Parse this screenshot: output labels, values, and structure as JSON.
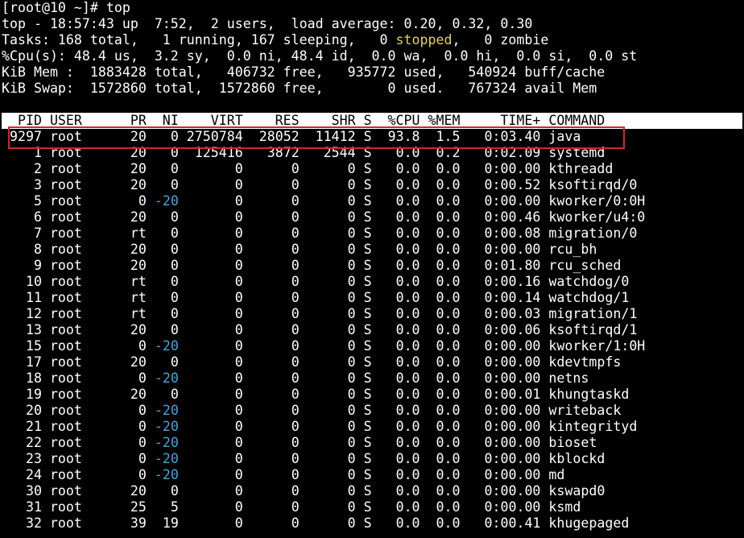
{
  "prompt": {
    "text": "[root@10 ~]# top"
  },
  "summary": {
    "uptime_line": "top - 18:57:43 up  7:52,  2 users,  load average: 0.20, 0.32, 0.30",
    "tasks_before": "Tasks: 168 total,   1 running, 167 sleeping,   0 ",
    "tasks_stopped_word": "stopped",
    "tasks_after": ",   0 zombie",
    "cpu_line": "%Cpu(s): 48.4 us,  3.2 sy,  0.0 ni, 48.4 id,  0.0 wa,  0.0 hi,  0.0 si,  0.0 st",
    "mem_line": "KiB Mem :  1883428 total,   406732 free,   935772 used,   540924 buff/cache",
    "swap_line": "KiB Swap:  1572860 total,  1572860 free,        0 used.   767324 avail Mem"
  },
  "table": {
    "header": "  PID USER      PR  NI    VIRT    RES    SHR S  %CPU %MEM     TIME+ COMMAND",
    "columns": [
      "PID",
      "USER",
      "PR",
      "NI",
      "VIRT",
      "RES",
      "SHR",
      "S",
      "%CPU",
      "%MEM",
      "TIME+",
      "COMMAND"
    ],
    "selected_pid": "9297",
    "rows": [
      {
        "pid": "9297",
        "user": "root",
        "pr": "20",
        "ni": "0",
        "virt": "2750784",
        "res": "28052",
        "shr": "11412",
        "s": "S",
        "cpu": "93.8",
        "mem": "1.5",
        "time": "0:03.40",
        "command": "java"
      },
      {
        "pid": "1",
        "user": "root",
        "pr": "20",
        "ni": "0",
        "virt": "125416",
        "res": "3872",
        "shr": "2544",
        "s": "S",
        "cpu": "0.0",
        "mem": "0.2",
        "time": "0:02.09",
        "command": "systemd"
      },
      {
        "pid": "2",
        "user": "root",
        "pr": "20",
        "ni": "0",
        "virt": "0",
        "res": "0",
        "shr": "0",
        "s": "S",
        "cpu": "0.0",
        "mem": "0.0",
        "time": "0:00.00",
        "command": "kthreadd"
      },
      {
        "pid": "3",
        "user": "root",
        "pr": "20",
        "ni": "0",
        "virt": "0",
        "res": "0",
        "shr": "0",
        "s": "S",
        "cpu": "0.0",
        "mem": "0.0",
        "time": "0:00.52",
        "command": "ksoftirqd/0"
      },
      {
        "pid": "5",
        "user": "root",
        "pr": "0",
        "ni": "-20",
        "virt": "0",
        "res": "0",
        "shr": "0",
        "s": "S",
        "cpu": "0.0",
        "mem": "0.0",
        "time": "0:00.00",
        "command": "kworker/0:0H"
      },
      {
        "pid": "6",
        "user": "root",
        "pr": "20",
        "ni": "0",
        "virt": "0",
        "res": "0",
        "shr": "0",
        "s": "S",
        "cpu": "0.0",
        "mem": "0.0",
        "time": "0:00.46",
        "command": "kworker/u4:0"
      },
      {
        "pid": "7",
        "user": "root",
        "pr": "rt",
        "ni": "0",
        "virt": "0",
        "res": "0",
        "shr": "0",
        "s": "S",
        "cpu": "0.0",
        "mem": "0.0",
        "time": "0:00.08",
        "command": "migration/0"
      },
      {
        "pid": "8",
        "user": "root",
        "pr": "20",
        "ni": "0",
        "virt": "0",
        "res": "0",
        "shr": "0",
        "s": "S",
        "cpu": "0.0",
        "mem": "0.0",
        "time": "0:00.00",
        "command": "rcu_bh"
      },
      {
        "pid": "9",
        "user": "root",
        "pr": "20",
        "ni": "0",
        "virt": "0",
        "res": "0",
        "shr": "0",
        "s": "S",
        "cpu": "0.0",
        "mem": "0.0",
        "time": "0:01.80",
        "command": "rcu_sched"
      },
      {
        "pid": "10",
        "user": "root",
        "pr": "rt",
        "ni": "0",
        "virt": "0",
        "res": "0",
        "shr": "0",
        "s": "S",
        "cpu": "0.0",
        "mem": "0.0",
        "time": "0:00.16",
        "command": "watchdog/0"
      },
      {
        "pid": "11",
        "user": "root",
        "pr": "rt",
        "ni": "0",
        "virt": "0",
        "res": "0",
        "shr": "0",
        "s": "S",
        "cpu": "0.0",
        "mem": "0.0",
        "time": "0:00.14",
        "command": "watchdog/1"
      },
      {
        "pid": "12",
        "user": "root",
        "pr": "rt",
        "ni": "0",
        "virt": "0",
        "res": "0",
        "shr": "0",
        "s": "S",
        "cpu": "0.0",
        "mem": "0.0",
        "time": "0:00.03",
        "command": "migration/1"
      },
      {
        "pid": "13",
        "user": "root",
        "pr": "20",
        "ni": "0",
        "virt": "0",
        "res": "0",
        "shr": "0",
        "s": "S",
        "cpu": "0.0",
        "mem": "0.0",
        "time": "0:00.06",
        "command": "ksoftirqd/1"
      },
      {
        "pid": "15",
        "user": "root",
        "pr": "0",
        "ni": "-20",
        "virt": "0",
        "res": "0",
        "shr": "0",
        "s": "S",
        "cpu": "0.0",
        "mem": "0.0",
        "time": "0:00.00",
        "command": "kworker/1:0H"
      },
      {
        "pid": "17",
        "user": "root",
        "pr": "20",
        "ni": "0",
        "virt": "0",
        "res": "0",
        "shr": "0",
        "s": "S",
        "cpu": "0.0",
        "mem": "0.0",
        "time": "0:00.00",
        "command": "kdevtmpfs"
      },
      {
        "pid": "18",
        "user": "root",
        "pr": "0",
        "ni": "-20",
        "virt": "0",
        "res": "0",
        "shr": "0",
        "s": "S",
        "cpu": "0.0",
        "mem": "0.0",
        "time": "0:00.00",
        "command": "netns"
      },
      {
        "pid": "19",
        "user": "root",
        "pr": "20",
        "ni": "0",
        "virt": "0",
        "res": "0",
        "shr": "0",
        "s": "S",
        "cpu": "0.0",
        "mem": "0.0",
        "time": "0:00.01",
        "command": "khungtaskd"
      },
      {
        "pid": "20",
        "user": "root",
        "pr": "0",
        "ni": "-20",
        "virt": "0",
        "res": "0",
        "shr": "0",
        "s": "S",
        "cpu": "0.0",
        "mem": "0.0",
        "time": "0:00.00",
        "command": "writeback"
      },
      {
        "pid": "21",
        "user": "root",
        "pr": "0",
        "ni": "-20",
        "virt": "0",
        "res": "0",
        "shr": "0",
        "s": "S",
        "cpu": "0.0",
        "mem": "0.0",
        "time": "0:00.00",
        "command": "kintegrityd"
      },
      {
        "pid": "22",
        "user": "root",
        "pr": "0",
        "ni": "-20",
        "virt": "0",
        "res": "0",
        "shr": "0",
        "s": "S",
        "cpu": "0.0",
        "mem": "0.0",
        "time": "0:00.00",
        "command": "bioset"
      },
      {
        "pid": "23",
        "user": "root",
        "pr": "0",
        "ni": "-20",
        "virt": "0",
        "res": "0",
        "shr": "0",
        "s": "S",
        "cpu": "0.0",
        "mem": "0.0",
        "time": "0:00.00",
        "command": "kblockd"
      },
      {
        "pid": "24",
        "user": "root",
        "pr": "0",
        "ni": "-20",
        "virt": "0",
        "res": "0",
        "shr": "0",
        "s": "S",
        "cpu": "0.0",
        "mem": "0.0",
        "time": "0:00.00",
        "command": "md"
      },
      {
        "pid": "30",
        "user": "root",
        "pr": "20",
        "ni": "0",
        "virt": "0",
        "res": "0",
        "shr": "0",
        "s": "S",
        "cpu": "0.0",
        "mem": "0.0",
        "time": "0:00.00",
        "command": "kswapd0"
      },
      {
        "pid": "31",
        "user": "root",
        "pr": "25",
        "ni": "5",
        "virt": "0",
        "res": "0",
        "shr": "0",
        "s": "S",
        "cpu": "0.0",
        "mem": "0.0",
        "time": "0:00.00",
        "command": "ksmd"
      },
      {
        "pid": "32",
        "user": "root",
        "pr": "39",
        "ni": "19",
        "virt": "0",
        "res": "0",
        "shr": "0",
        "s": "S",
        "cpu": "0.0",
        "mem": "0.0",
        "time": "0:00.41",
        "command": "khugepaged"
      }
    ]
  },
  "colors": {
    "background": "#000000",
    "foreground": "#ffffff",
    "stopped_highlight": "#e6d34a",
    "negative_nice": "#4aa3df",
    "header_bg": "#ffffff",
    "header_fg": "#000000",
    "selection_box": "#d9232a"
  }
}
